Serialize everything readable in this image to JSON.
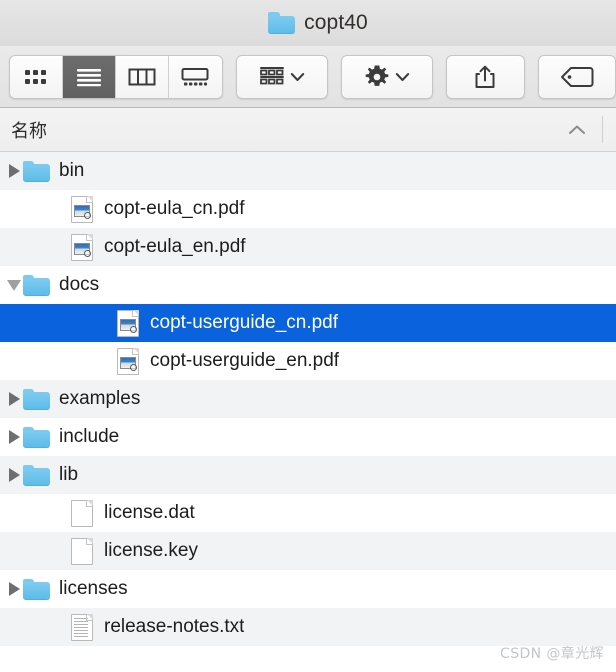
{
  "window": {
    "title": "copt40",
    "title_icon": "folder-icon"
  },
  "toolbar": {
    "view_modes": [
      {
        "name": "icon-view",
        "icon": "grid-icon",
        "active": false
      },
      {
        "name": "list-view",
        "icon": "list-icon",
        "active": true
      },
      {
        "name": "column-view",
        "icon": "columns-icon",
        "active": false
      },
      {
        "name": "gallery-view",
        "icon": "gallery-icon",
        "active": false
      }
    ],
    "group_button": {
      "name": "group-by-button",
      "icon": "group-icon",
      "chevron": "chevron-down-icon"
    },
    "action_button": {
      "name": "action-button",
      "icon": "gear-icon",
      "chevron": "chevron-down-icon"
    },
    "share_button": {
      "name": "share-button",
      "icon": "share-icon"
    },
    "tag_button": {
      "name": "tag-button",
      "icon": "tag-icon"
    }
  },
  "column_header": {
    "name_label": "名称",
    "sort_direction": "ascending",
    "sort_icon": "chevron-up-icon"
  },
  "files": [
    {
      "name": "bin",
      "type": "folder",
      "icon": "folder-icon",
      "indent": 0,
      "disclosure": "collapsed",
      "stripe": true,
      "selected": false
    },
    {
      "name": "copt-eula_cn.pdf",
      "type": "pdf",
      "icon": "pdf-icon",
      "indent": 1,
      "disclosure": "none",
      "stripe": false,
      "selected": false
    },
    {
      "name": "copt-eula_en.pdf",
      "type": "pdf",
      "icon": "pdf-icon",
      "indent": 1,
      "disclosure": "none",
      "stripe": true,
      "selected": false
    },
    {
      "name": "docs",
      "type": "folder",
      "icon": "folder-icon",
      "indent": 0,
      "disclosure": "expanded",
      "stripe": false,
      "selected": false
    },
    {
      "name": "copt-userguide_cn.pdf",
      "type": "pdf",
      "icon": "pdf-icon",
      "indent": 2,
      "disclosure": "none",
      "stripe": false,
      "selected": true
    },
    {
      "name": "copt-userguide_en.pdf",
      "type": "pdf",
      "icon": "pdf-icon",
      "indent": 2,
      "disclosure": "none",
      "stripe": false,
      "selected": false
    },
    {
      "name": "examples",
      "type": "folder",
      "icon": "folder-icon",
      "indent": 0,
      "disclosure": "collapsed",
      "stripe": true,
      "selected": false
    },
    {
      "name": "include",
      "type": "folder",
      "icon": "folder-icon",
      "indent": 0,
      "disclosure": "collapsed",
      "stripe": false,
      "selected": false
    },
    {
      "name": "lib",
      "type": "folder",
      "icon": "folder-icon",
      "indent": 0,
      "disclosure": "collapsed",
      "stripe": true,
      "selected": false
    },
    {
      "name": "license.dat",
      "type": "blank",
      "icon": "document-icon",
      "indent": 1,
      "disclosure": "none",
      "stripe": false,
      "selected": false
    },
    {
      "name": "license.key",
      "type": "blank",
      "icon": "document-icon",
      "indent": 1,
      "disclosure": "none",
      "stripe": true,
      "selected": false
    },
    {
      "name": "licenses",
      "type": "folder",
      "icon": "folder-icon",
      "indent": 0,
      "disclosure": "collapsed",
      "stripe": false,
      "selected": false
    },
    {
      "name": "release-notes.txt",
      "type": "text",
      "icon": "text-document-icon",
      "indent": 1,
      "disclosure": "none",
      "stripe": true,
      "selected": false
    }
  ],
  "watermark": {
    "text": "CSDN @章光辉"
  },
  "colors": {
    "selection_blue": "#0A63DC",
    "stripe_gray": "#F2F3F4",
    "folder_blue": "#5CBBE9",
    "toolbar_gray": "#E6E6E6",
    "active_segment": "#666666"
  }
}
